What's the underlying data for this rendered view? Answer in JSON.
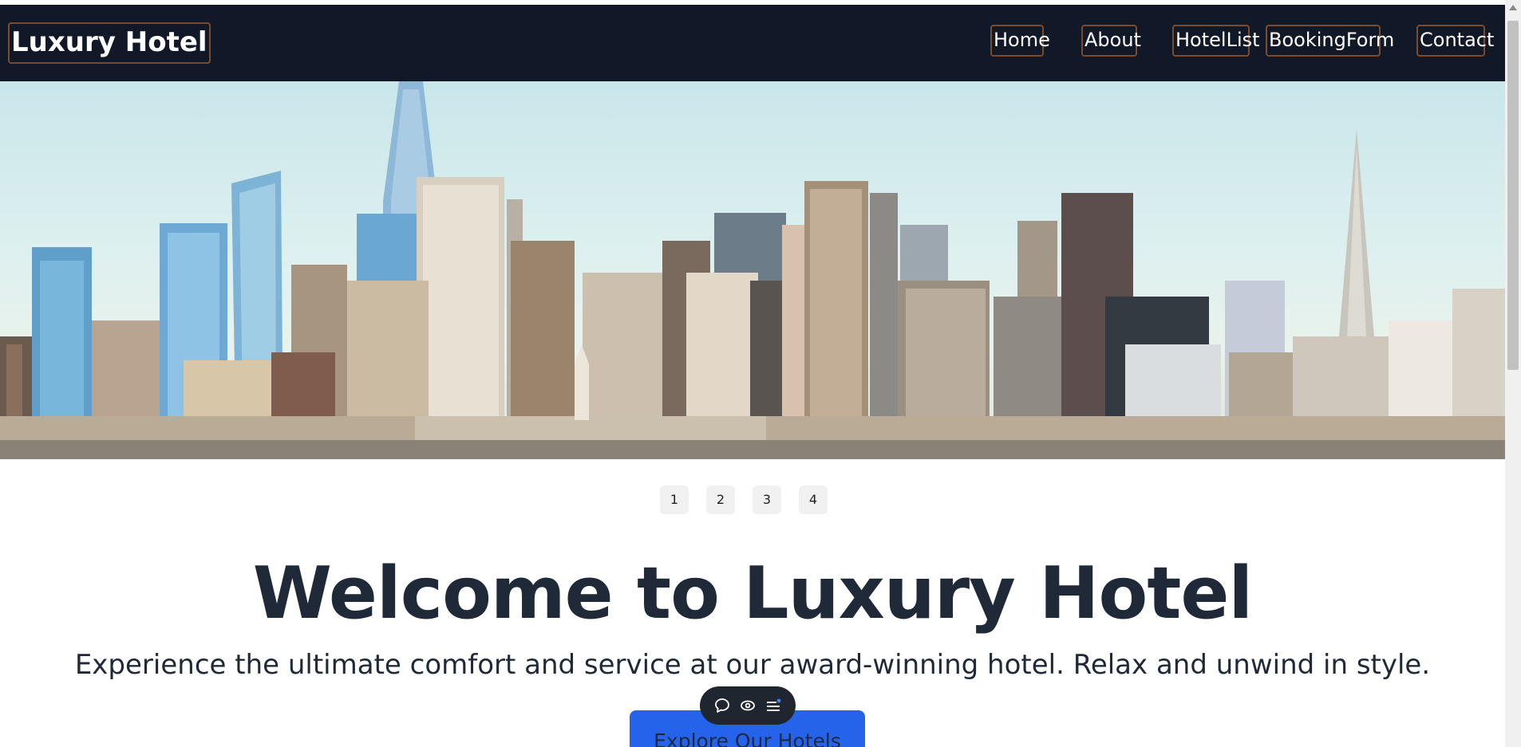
{
  "navbar": {
    "brand": "Luxury Hotel",
    "links": [
      "Home",
      "About",
      "HotelList",
      "BookingForm",
      "Contact"
    ]
  },
  "hero": {
    "slide_buttons": [
      "1",
      "2",
      "3",
      "4"
    ]
  },
  "main": {
    "headline": "Welcome to Luxury Hotel",
    "subheadline": "Experience the ultimate comfort and service at our award-winning hotel. Relax and unwind in style.",
    "cta_label": "Explore Our Hotels"
  },
  "floating_toolbar": {
    "icons": [
      "chat-bubble-icon",
      "eye-icon",
      "menu-list-icon"
    ]
  },
  "colors": {
    "navbar_bg": "#111827",
    "nav_link_border": "#7c4a2d",
    "cta_bg": "#2563eb",
    "headline": "#1f2937"
  }
}
